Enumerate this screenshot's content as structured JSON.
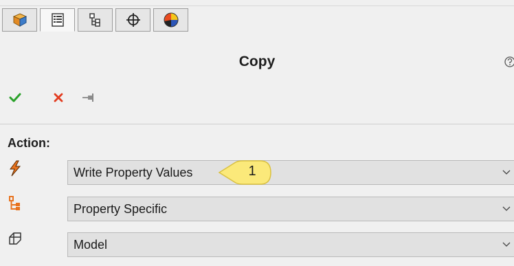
{
  "tabs": [
    {
      "icon": "part-cube-icon"
    },
    {
      "icon": "property-manager-icon",
      "active": true
    },
    {
      "icon": "configuration-manager-icon"
    },
    {
      "icon": "crosshair-icon"
    },
    {
      "icon": "display-manager-icon"
    }
  ],
  "panel": {
    "title": "Copy"
  },
  "toolbar": {
    "ok_icon": "checkmark-icon",
    "cancel_icon": "x-icon",
    "pin_icon": "pushpin-icon"
  },
  "section": {
    "label": "Action:",
    "rows": [
      {
        "icon": "lightning-icon",
        "value": "Write Property Values"
      },
      {
        "icon": "property-tree-icon",
        "value": "Property Specific"
      },
      {
        "icon": "model-icon",
        "value": "Model"
      }
    ]
  },
  "callout": {
    "number": "1",
    "color": "#fbe97a"
  },
  "colors": {
    "ok": "#2aa12a",
    "cancel": "#e23b1f",
    "accent_orange": "#e8731f"
  }
}
